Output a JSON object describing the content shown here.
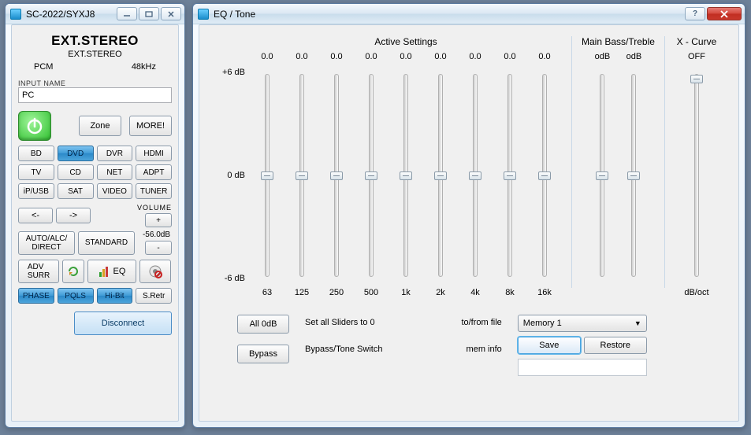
{
  "left": {
    "title": "SC-2022/SYXJ8",
    "display": {
      "main": "EXT.STEREO",
      "sub": "EXT.STEREO",
      "format": "PCM",
      "rate": "48kHz"
    },
    "input_name_label": "INPUT NAME",
    "input_name_value": "PC",
    "zone": "Zone",
    "more": "MORE!",
    "inputs": [
      "BD",
      "DVD",
      "DVR",
      "HDMI",
      "TV",
      "CD",
      "NET",
      "ADPT",
      "iP/USB",
      "SAT",
      "VIDEO",
      "TUNER"
    ],
    "input_selected": "DVD",
    "nav": {
      "prev": "<-",
      "next": "->"
    },
    "volume": {
      "label": "VOLUME",
      "plus": "+",
      "value": "-56.0dB",
      "minus": "-"
    },
    "auto": "AUTO/ALC/\nDIRECT",
    "standard": "STANDARD",
    "advsurr": "ADV\nSURR",
    "eq": "EQ",
    "toggles": [
      "PHASE",
      "PQLS",
      "Hi-Bit",
      "S.Retr"
    ],
    "disconnect": "Disconnect"
  },
  "right": {
    "title": "EQ / Tone",
    "group1_header": "Active Settings",
    "group2_header": "Main Bass/Treble",
    "group3_header": "X - Curve",
    "db_labels": [
      "+6 dB",
      "0 dB",
      "-6 dB"
    ],
    "eq_bands": {
      "labels": [
        "63",
        "125",
        "250",
        "500",
        "1k",
        "2k",
        "4k",
        "8k",
        "16k"
      ],
      "values": [
        "0.0",
        "0.0",
        "0.0",
        "0.0",
        "0.0",
        "0.0",
        "0.0",
        "0.0",
        "0.0"
      ]
    },
    "tone": {
      "labels": [
        "",
        ""
      ],
      "values": [
        "odB",
        "odB"
      ]
    },
    "xcurve": {
      "value": "OFF",
      "bot": "dB/oct"
    },
    "all0db": "All 0dB",
    "all0db_desc": "Set all Sliders to 0",
    "bypass": "Bypass",
    "bypass_desc": "Bypass/Tone Switch",
    "tofrom": "to/from file",
    "meminfo": "mem info",
    "memory": "Memory 1",
    "save": "Save",
    "restore": "Restore"
  }
}
